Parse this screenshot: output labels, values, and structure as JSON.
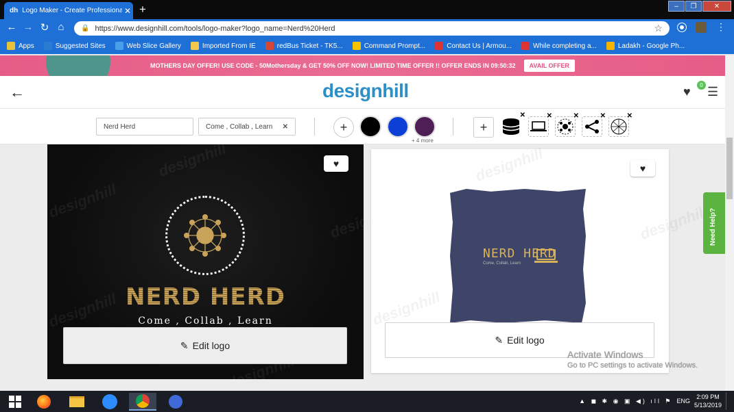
{
  "browser": {
    "tab_title": "Logo Maker - Create Professiona",
    "tab_favicon": "dh",
    "url": "https://www.designhill.com/tools/logo-maker?logo_name=Nerd%20Herd",
    "bookmarks": [
      {
        "label": "Apps",
        "icon": "apps-grid-icon",
        "color": "#e8c13a"
      },
      {
        "label": "Suggested Sites",
        "icon": "suggested-icon",
        "color": "#2a7bd2"
      },
      {
        "label": "Web Slice Gallery",
        "icon": "ie-icon",
        "color": "#48a0e8"
      },
      {
        "label": "Imported From IE",
        "icon": "folder-icon",
        "color": "#f2c94c"
      },
      {
        "label": "redBus Ticket - TK5...",
        "icon": "gmail-icon",
        "color": "#d44638"
      },
      {
        "label": "Command Prompt...",
        "icon": "bookmark-icon",
        "color": "#f5c400"
      },
      {
        "label": "Contact Us | Armou...",
        "icon": "page-icon",
        "color": "#d33"
      },
      {
        "label": "While completing a...",
        "icon": "q-icon",
        "color": "#d33"
      },
      {
        "label": "Ladakh - Google Ph...",
        "icon": "photos-icon",
        "color": "#f4b400"
      }
    ]
  },
  "offer": {
    "text": "MOTHERS DAY OFFER! USE CODE - 50Mothersday & GET 50% OFF NOW! LIMITED TIME OFFER !! OFFER ENDS IN 09:50:32",
    "button": "AVAIL OFFER"
  },
  "header": {
    "brand_a": "design",
    "brand_b": "hill",
    "wishlist_count": "0"
  },
  "filters": {
    "name_value": "Nerd Herd",
    "slogan_value": "Come , Collab , Learn",
    "colors": [
      "#000000",
      "#0b3fd6",
      "#4e1f55"
    ],
    "more_colors": "+ 4 more"
  },
  "logos": [
    {
      "name": "NERD HERD",
      "tagline": "Come , Collab , Learn",
      "edit_label": "Edit logo",
      "watermark": "designhill"
    },
    {
      "name": "NERD HERD",
      "tagline": "Come, Collab, Learn",
      "edit_label": "Edit logo",
      "watermark": "designhill"
    }
  ],
  "help": "Need Help?",
  "windows_activation": {
    "title": "Activate Windows",
    "subtitle": "Go to PC settings to activate Windows."
  },
  "taskbar": {
    "lang": "ENG",
    "time": "2:09 PM",
    "date": "5/13/2019"
  }
}
